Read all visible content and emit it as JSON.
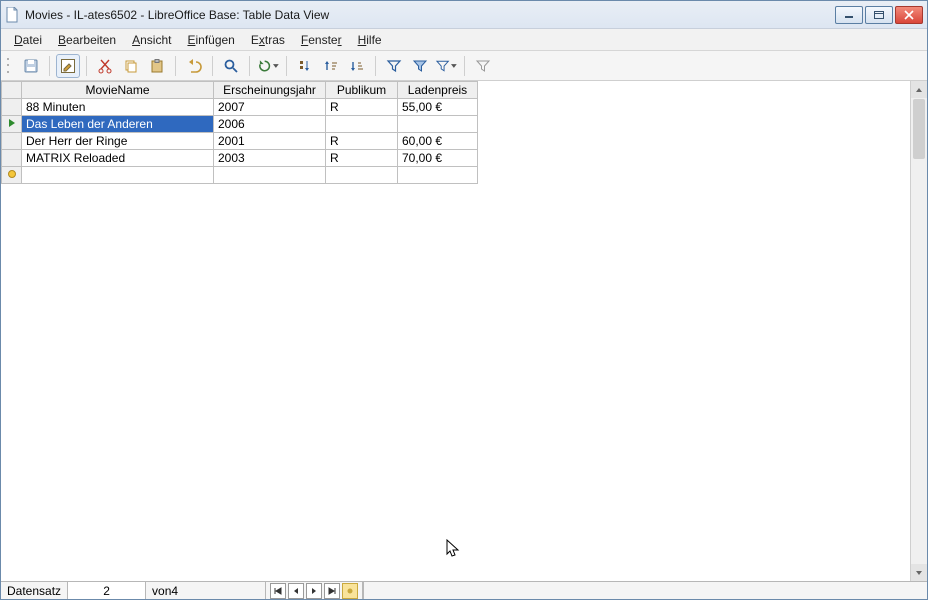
{
  "title": "Movies - IL-ates6502 - LibreOffice Base: Table Data View",
  "menu": [
    "Datei",
    "Bearbeiten",
    "Ansicht",
    "Einfügen",
    "Extras",
    "Fenster",
    "Hilfe"
  ],
  "columns": [
    {
      "label": "MovieName"
    },
    {
      "label": "Erscheinungsjahr"
    },
    {
      "label": "Publikum"
    },
    {
      "label": "Ladenpreis"
    }
  ],
  "rows": [
    {
      "name": "88 Minuten",
      "year": "2007",
      "pub": "R",
      "price": "55,00 €",
      "state": ""
    },
    {
      "name": "Das Leben der Anderen",
      "year": "2006",
      "pub": "",
      "price": "",
      "state": "current"
    },
    {
      "name": "Der Herr der Ringe",
      "year": "2001",
      "pub": "R",
      "price": "60,00 €",
      "state": ""
    },
    {
      "name": "MATRIX Reloaded",
      "year": "2003",
      "pub": "R",
      "price": "70,00 €",
      "state": ""
    }
  ],
  "navigator": {
    "label": "Datensatz",
    "current": "2",
    "total_prefix": "von ",
    "total": "4"
  },
  "icons": {
    "save": "save-icon",
    "edit": "edit-icon",
    "cut": "cut-icon",
    "copy": "copy-icon",
    "paste": "paste-icon",
    "undo": "undo-icon",
    "find": "find-icon",
    "refresh": "refresh-icon",
    "sortdlg": "sort-dialog-icon",
    "sortasc": "sort-asc-icon",
    "sortdesc": "sort-desc-icon",
    "autofilter": "autofilter-icon",
    "applyfilter": "applyfilter-icon",
    "stdfilter": "stdfilter-icon",
    "removefilter": "removefilter-icon"
  }
}
